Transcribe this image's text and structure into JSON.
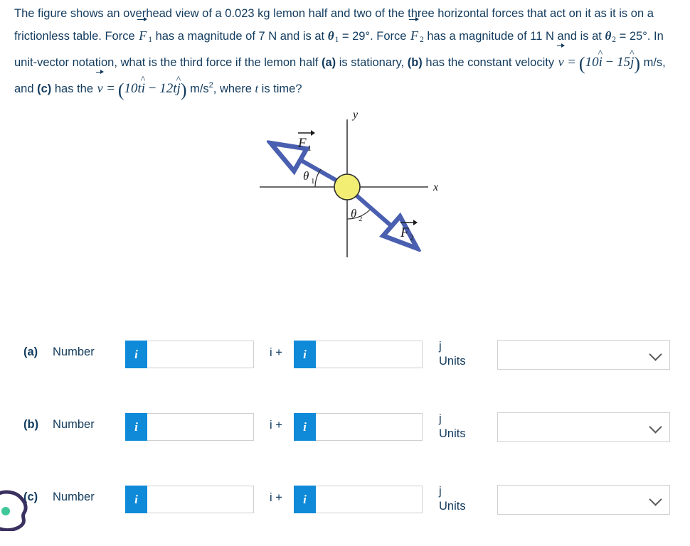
{
  "problem": {
    "line1_a": "The figure shows an overhead view of a ",
    "mass": "0.023 kg",
    "line1_b": " lemon half and two of the three horizontal forces that act on it as it is on a frictionless table. Force ",
    "force1_symbol": "F",
    "force1_sub": "1",
    "line2_a": " has a magnitude of ",
    "force1_magnitude": "7 N",
    "line2_b": " and is at ",
    "theta1_symbol": "θ",
    "theta1_sub": "1",
    "theta1_value": "= 29°",
    "line2_c": ". Force ",
    "force2_symbol": "F",
    "force2_sub": "2",
    "line3_a": " has a magnitude of ",
    "force2_magnitude": "11 N",
    "line3_b": " and is at ",
    "theta2_symbol": "θ",
    "theta2_sub": "2",
    "theta2_value": "= 25°",
    "line3_c": ". In unit-vector notation, what is the third force if the lemon half ",
    "part_a_tag": "(a)",
    "line4_a": " is stationary, ",
    "part_b_tag": "(b)",
    "line4_b": " has the constant velocity ",
    "v_symbol": "v",
    "eq": " = ",
    "vb_open": "(",
    "vb_x": "10",
    "vb_i": "i",
    "vb_minus": " − ",
    "vb_y": "15",
    "vb_j": "j",
    "vb_close": ")",
    "vb_units": " m/s, and ",
    "part_c_tag": "(c)",
    "line5_a": " has the ",
    "vc_open": "(",
    "vc_x": "10t",
    "vc_i": "i",
    "vc_minus": " − ",
    "vc_y": "12t",
    "vc_j": "j",
    "vc_close": ")",
    "vc_units": " m/s",
    "vc_sup": "2",
    "line5_b": ", where ",
    "t_symbol": "t",
    "line5_c": " is time?"
  },
  "figure": {
    "axis_x_label": "x",
    "axis_y_label": "y",
    "force1_label": "F",
    "force1_sub": "1",
    "force2_label": "F",
    "force2_sub": "2",
    "theta1_label": "θ",
    "theta1_sub": "1",
    "theta2_label": "θ",
    "theta2_sub": "2",
    "colors": {
      "arrow": "#4a5fb0",
      "lemon_fill": "#f2ee74",
      "lemon_stroke": "#2d2d2d",
      "axis": "#3a3a3a"
    }
  },
  "answers": {
    "number_label": "Number",
    "i_plus_label": "i +",
    "j_label": "j",
    "units_label": "Units",
    "info_icon_label": "i",
    "input_placeholder": "",
    "select_value": "",
    "rows": [
      {
        "tag": "(a)",
        "value_i": "",
        "value_j": "",
        "unit": ""
      },
      {
        "tag": "(b)",
        "value_i": "",
        "value_j": "",
        "unit": ""
      },
      {
        "tag": "(c)",
        "value_i": "",
        "value_j": "",
        "unit": ""
      }
    ]
  },
  "colors": {
    "accent_blue": "#0e8ad8",
    "text_navy": "#123b5e",
    "border_grey": "#cfcfcf",
    "widget_purple": "#3b3160",
    "widget_green": "#3fc79a"
  }
}
